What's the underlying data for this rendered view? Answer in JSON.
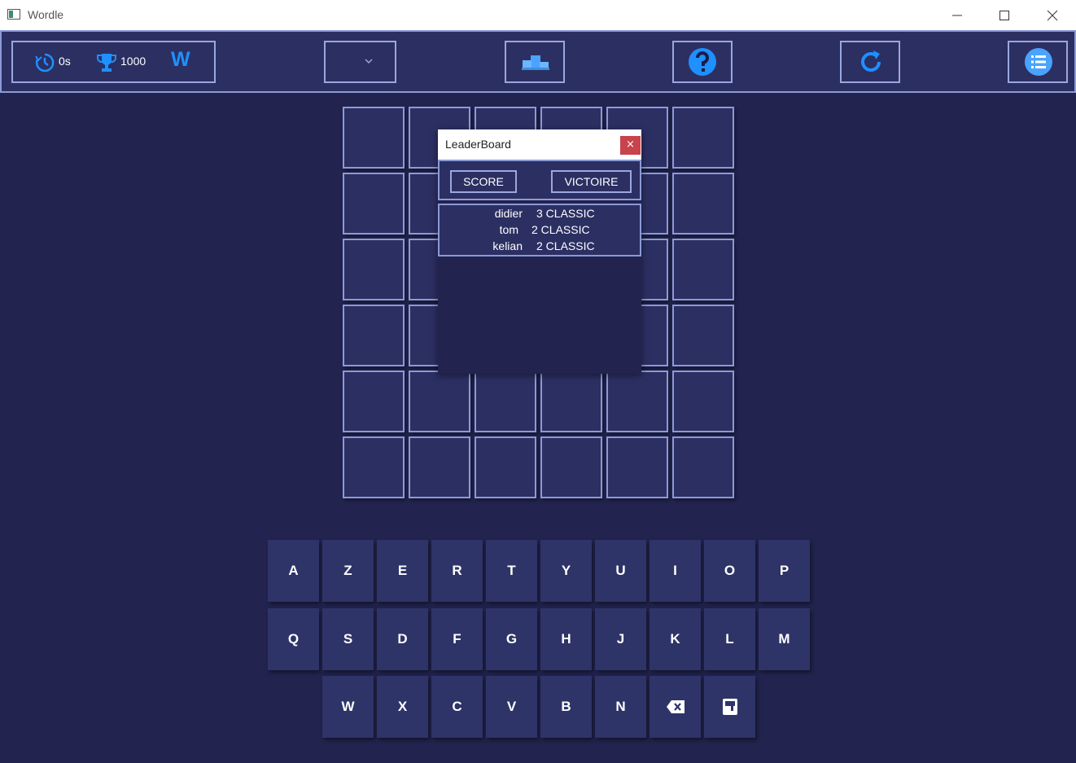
{
  "window": {
    "title": "Wordle"
  },
  "toolbar": {
    "timer_value": "0s",
    "score_value": "1000",
    "logo_letter": "W"
  },
  "keyboard": {
    "row1": [
      "A",
      "Z",
      "E",
      "R",
      "T",
      "Y",
      "U",
      "I",
      "O",
      "P"
    ],
    "row2": [
      "Q",
      "S",
      "D",
      "F",
      "G",
      "H",
      "J",
      "K",
      "L",
      "M"
    ],
    "row3": [
      "W",
      "X",
      "C",
      "V",
      "B",
      "N"
    ]
  },
  "leaderboard": {
    "title": "LeaderBoard",
    "close_label": "×",
    "tab_score": "SCORE",
    "tab_victory": "VICTOIRE",
    "entries": [
      {
        "name": "didier",
        "score": "3 CLASSIC"
      },
      {
        "name": "tom",
        "score": "2 CLASSIC"
      },
      {
        "name": "kelian",
        "score": "2 CLASSIC"
      }
    ]
  },
  "colors": {
    "background": "#22244f",
    "panel": "#2c2f62",
    "border": "#8c9ad6",
    "accent": "#1e90ff",
    "close": "#c8434b"
  },
  "icons": [
    "app-icon",
    "minimize-icon",
    "maximize-icon",
    "close-icon",
    "timer-icon",
    "trophy-icon",
    "chevron-down-icon",
    "podium-icon",
    "help-icon",
    "refresh-icon",
    "list-menu-icon",
    "backspace-icon",
    "enter-icon"
  ]
}
